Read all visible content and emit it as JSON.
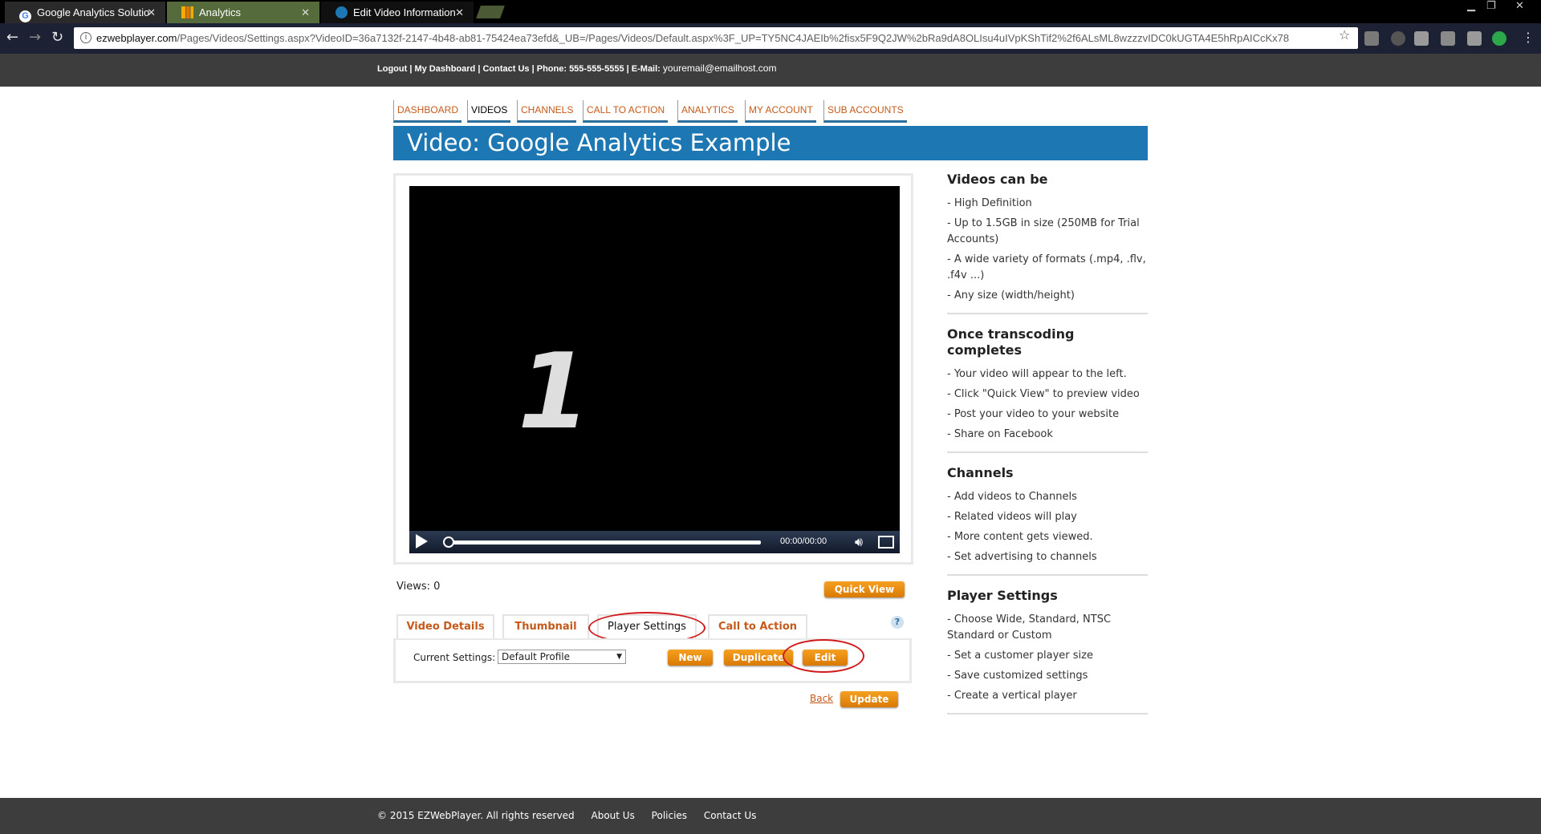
{
  "browser": {
    "tabs": [
      {
        "title": "Google Analytics Solutio"
      },
      {
        "title": "Analytics"
      },
      {
        "title": "Edit Video Information"
      }
    ],
    "url_host": "ezwebplayer.com",
    "url_path": "/Pages/Videos/Settings.aspx?VideoID=36a7132f-2147-4b48-ab81-75424ea73efd&_UB=/Pages/Videos/Default.aspx%3F_UP=TY5NC4JAEIb%2fisx5F9Q2JW%2bRa9dA8OLIsu4uIVpKShTif2%2f6ALsML8wzzzvIDC0kUGTA4E5hRpAICcKx78"
  },
  "header": {
    "logout": "Logout",
    "dashboard": "My Dashboard",
    "contact": "Contact Us",
    "phone": "Phone: 555-555-5555",
    "email_label": "E-Mail:",
    "email": "youremail@emailhost.com"
  },
  "nav": {
    "dashboard": "DASHBOARD",
    "videos": "VIDEOS",
    "channels": "CHANNELS",
    "cta": "CALL TO ACTION",
    "analytics": "ANALYTICS",
    "account": "MY ACCOUNT",
    "sub": "SUB ACCOUNTS"
  },
  "page_title": "Video: Google Analytics Example",
  "player": {
    "frame_digit": "1",
    "time": "00:00/00:00",
    "progress": 0
  },
  "views": "Views: 0",
  "buttons": {
    "quick_view": "Quick View",
    "new": "New",
    "duplicate": "Duplicate",
    "edit": "Edit",
    "update": "Update",
    "back": "Back"
  },
  "tabs": {
    "details": "Video Details",
    "thumbnail": "Thumbnail",
    "player_settings": "Player Settings",
    "cta": "Call to Action",
    "help": "?"
  },
  "settings": {
    "label": "Current Settings:",
    "selected": "Default Profile"
  },
  "sidebar": [
    {
      "title": "Videos can be",
      "items": [
        "- High Definition",
        "- Up to 1.5GB in size (250MB for Trial Accounts)",
        "- A wide variety of formats (.mp4, .flv, .f4v ...)",
        "- Any size (width/height)"
      ]
    },
    {
      "title": "Once transcoding completes",
      "items": [
        "- Your video will appear to the left.",
        "- Click \"Quick View\" to preview video",
        "- Post your video to your website",
        "- Share on Facebook"
      ]
    },
    {
      "title": "Channels",
      "items": [
        "- Add videos to Channels",
        "- Related videos will play",
        "- More content gets viewed.",
        "- Set advertising to channels"
      ]
    },
    {
      "title": "Player Settings",
      "items": [
        "- Choose Wide, Standard, NTSC Standard or Custom",
        "- Set a customer player size",
        "- Save customized settings",
        "- Create a vertical player"
      ]
    }
  ],
  "footer": {
    "copyright": "© 2015 EZWebPlayer. All rights reserved",
    "about": "About Us",
    "policies": "Policies",
    "contact": "Contact Us"
  },
  "colors": {
    "accent_orange": "#c55a1a",
    "button_orange": "#f39c12",
    "title_blue": "#1d77b3",
    "annotation_red": "#d11a1a"
  },
  "icons": {
    "back": "arrow-left",
    "forward": "arrow-right",
    "reload": "reload",
    "bookmark": "star",
    "play": "play",
    "volume": "speaker",
    "fullscreen": "fullscreen"
  }
}
